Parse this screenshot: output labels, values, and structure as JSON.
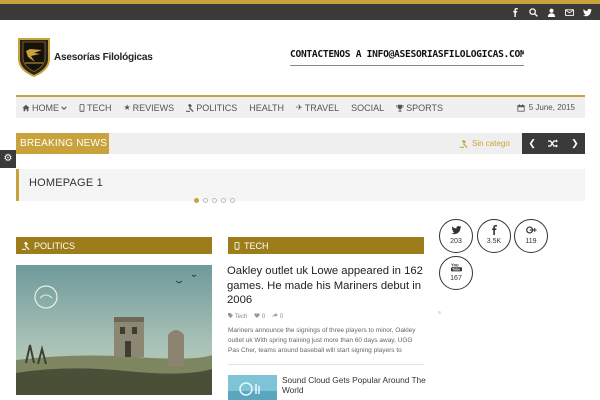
{
  "topbar": {
    "icons": [
      "facebook-icon",
      "search-icon",
      "user-icon",
      "mail-icon",
      "twitter-icon"
    ]
  },
  "site": {
    "logo_text": "Asesorías Filológicas",
    "contact": "CONTACTENOS A INFO@ASESORIASFILOLOGICAS.COM"
  },
  "nav": {
    "items": [
      {
        "label": "HOME",
        "icon": "home-icon"
      },
      {
        "label": "TECH",
        "icon": "mobile-icon"
      },
      {
        "label": "REVIEWS",
        "icon": "star-icon"
      },
      {
        "label": "POLITICS",
        "icon": "gavel-icon"
      },
      {
        "label": "HEALTH",
        "icon": ""
      },
      {
        "label": "TRAVEL",
        "icon": "plane-icon"
      },
      {
        "label": "SOCIAL",
        "icon": ""
      },
      {
        "label": "SPORTS",
        "icon": "trophy-icon"
      }
    ],
    "date": "5 June, 2015"
  },
  "breaking": {
    "label": "BREAKING NEWS",
    "ticker": "Sin catego"
  },
  "homepage": {
    "title": "HOMEPAGE 1"
  },
  "slider": {
    "total": 5,
    "active_index": 0
  },
  "sections": {
    "politics": {
      "label": "POLITICS",
      "icon": "gavel-icon"
    },
    "tech": {
      "label": "TECH",
      "icon": "mobile-icon"
    }
  },
  "tech_article": {
    "title": "Oakley outlet uk  Lowe appeared in 162 games. He made his Mariners debut in 2006",
    "category": "Tech",
    "likes": "0",
    "shares": "0",
    "excerpt": "Mariners announce the signings of three players to minor, Oakley outlet uk With spring training just more than 60 days away, UGG Pas Cher, teams around baseball will start signing players to"
  },
  "small_article": {
    "title": "Sound Cloud Gets Popular Around The World"
  },
  "social": [
    {
      "network": "twitter",
      "icon": "twitter-icon",
      "count": "203"
    },
    {
      "network": "facebook",
      "icon": "facebook-icon",
      "count": "3.5K"
    },
    {
      "network": "google-plus",
      "icon": "google-plus-icon",
      "count": "119"
    },
    {
      "network": "youtube",
      "icon": "youtube-icon",
      "count": "167"
    }
  ],
  "colors": {
    "accent": "#c8a23a",
    "section_bar": "#9c7d1a",
    "dark": "#3a3a3a"
  }
}
